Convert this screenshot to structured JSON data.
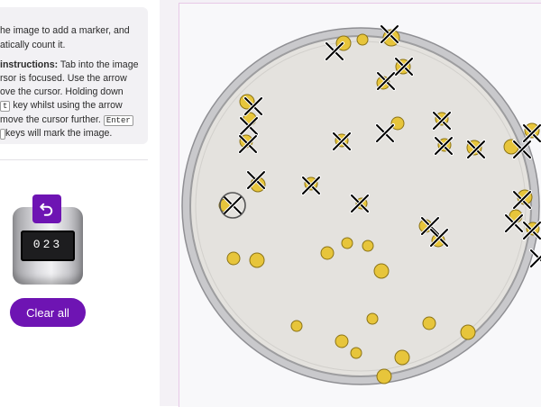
{
  "instructions": {
    "line1": "he image to add a marker, and",
    "line2": "atically count it.",
    "heading": "instructions:",
    "line3_rest": " Tab into the image",
    "line4": "rsor is focused. Use the arrow",
    "line5": "ove the cursor. Holding down",
    "kbd_shift": "t",
    "line6_rest": " key whilst using the arrow",
    "line7": "move the cursor further. ",
    "kbd_enter": "Enter",
    "kbd_space": "",
    "line8_rest": " keys will mark the image."
  },
  "counter": {
    "digits": "023",
    "reset_icon": "undo-icon"
  },
  "buttons": {
    "clear_all": "Clear all"
  },
  "colors": {
    "accent": "#6e14b3",
    "colony": "#e7c53b",
    "colony_outline": "#8c7416",
    "plate_rim": "#a9a9ab",
    "agar": "#e4e2de"
  }
}
